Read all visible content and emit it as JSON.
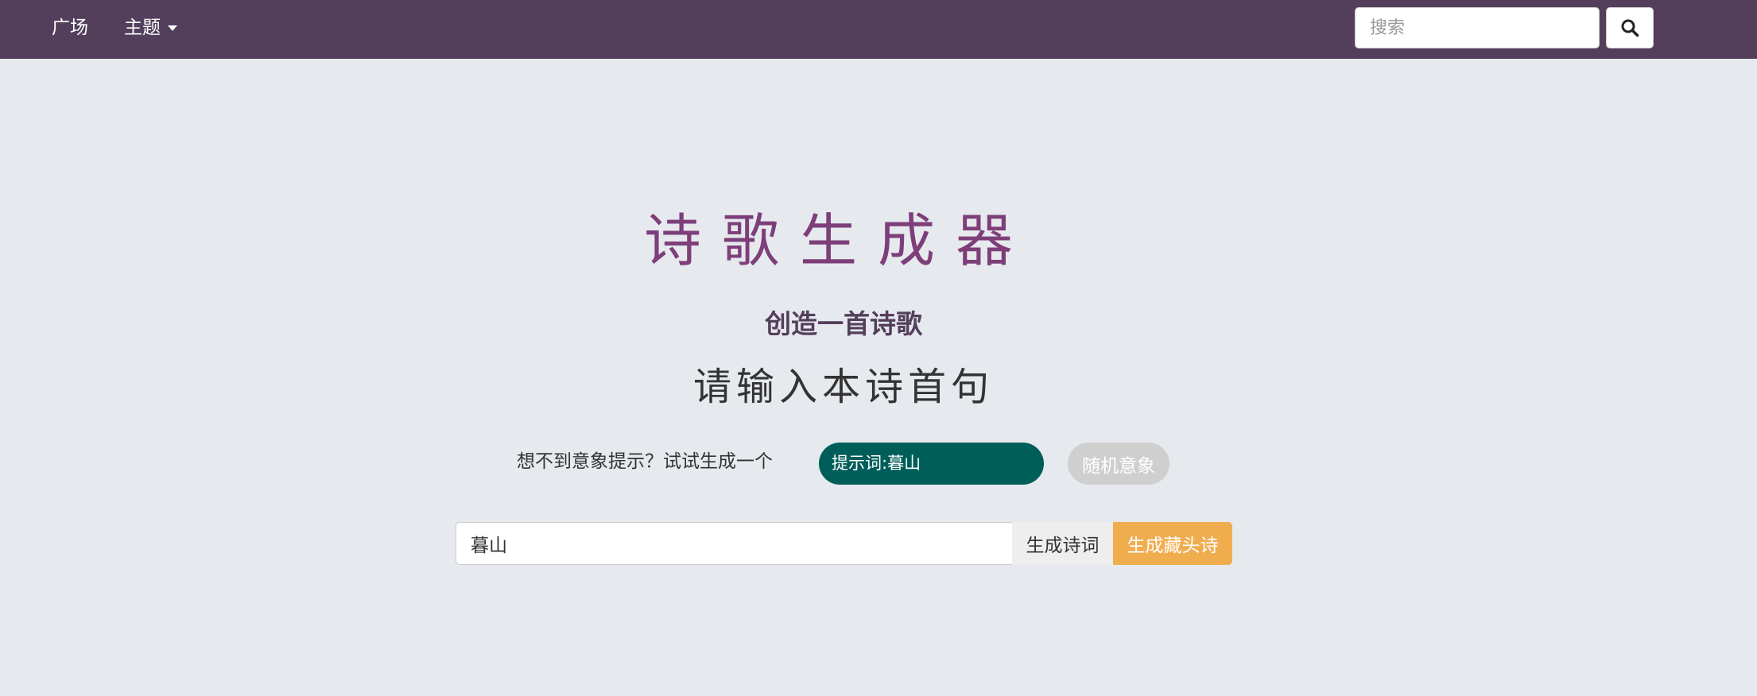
{
  "navbar": {
    "plaza_label": "广场",
    "topic_label": "主题",
    "search": {
      "placeholder": "搜索",
      "icon": "search-icon"
    },
    "background_color": "#533f5b"
  },
  "main": {
    "title": "诗歌生成器",
    "subtitle": "创造一首诗歌",
    "prompt_heading": "请输入本诗首句",
    "hint_text": "想不到意象提示？试试生成一个",
    "keyword_pill": "提示词:暮山",
    "random_button": "随机意象",
    "poem_input_value": "暮山",
    "generate_poem_button": "生成诗词",
    "generate_acrostic_button": "生成藏头诗"
  },
  "colors": {
    "title": "#7d3e7a",
    "keyword_pill": "#005e5a",
    "acrostic_button": "#f0ad4e",
    "page_background": "#e6e9ed"
  }
}
